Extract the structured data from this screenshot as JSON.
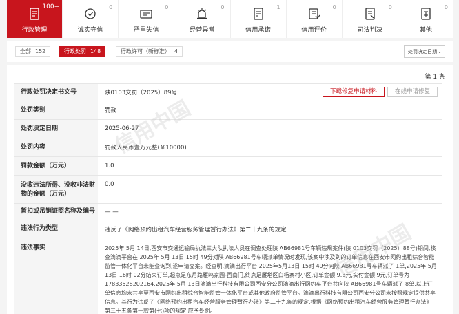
{
  "categories": [
    {
      "label": "行政管理",
      "count": "100+",
      "icon": "admin-doc-icon",
      "active": true
    },
    {
      "label": "诚实守信",
      "count": "0",
      "icon": "integrity-shield-icon",
      "active": false
    },
    {
      "label": "严重失信",
      "count": "0",
      "icon": "blacklist-icon",
      "active": false
    },
    {
      "label": "经营异常",
      "count": "0",
      "icon": "alarm-icon",
      "active": false
    },
    {
      "label": "信用承诺",
      "count": "1",
      "icon": "commitment-icon",
      "active": false
    },
    {
      "label": "信用评价",
      "count": "0",
      "icon": "evaluation-icon",
      "active": false
    },
    {
      "label": "司法判决",
      "count": "0",
      "icon": "judgment-icon",
      "active": false
    },
    {
      "label": "其他",
      "count": "0",
      "icon": "other-icon",
      "active": false
    }
  ],
  "filters": {
    "all_label": "全部",
    "all_count": "152",
    "penalty_label": "行政处罚",
    "penalty_count": "148",
    "permit_label": "行政许可（新标准）",
    "permit_count": "4",
    "sort_label": "处罚决定日期"
  },
  "page_note": "第 1 条",
  "actions": {
    "download": "下载修复申请材料",
    "online_repair": "在线申请修复"
  },
  "watermark": "信用中国",
  "detail": {
    "decision_no_key": "行政处罚决定书文号",
    "decision_no": "陕0103交罚（2025）89号",
    "category_key": "处罚类别",
    "category": "罚款",
    "date_key": "处罚决定日期",
    "date": "2025-06-27",
    "content_key": "处罚内容",
    "content": "罚款人民币壹万元整(￥10000)",
    "fine_key": "罚款金额（万元）",
    "fine": "1.0",
    "confiscate_key": "没收违法所得、没收非法财物的金额（万元）",
    "confiscate": "0.0",
    "license_key": "暂扣或吊销证照名称及编号",
    "license": "— —",
    "violation_type_key": "违法行为类型",
    "violation_type": "违反了《网络预约出租汽车经营服务管理暂行办法》第二十九条的规定",
    "facts_key": "违法事实",
    "facts": "2025年 5月 14日,西安市交通运输局执法三大队执法人员在调查处理陕 AB66981号车辆违规案件(陕 0103交罚（2025）88号)期间,核查滴滴平台在 2025年 5月 13日 15时 49分对陕 AB66981号车辆派单情况时发现,该案中涉及到的订单信息在西安市网约出租综合智能监管一体化平台未能查询到,遂申请立案。经查明,滴滴出行平台 2025年5月13日 15时 49分向陕 AB66981号车辆派了 1单,2025年 5月 13日 16时 02分结束订单,起点是东月路雁鸣家园-西南门,终点是雁塔区白杨寨村小区,订单金额 9.3元,实付金额 9元,订单号为 17833528202164,2025年 5月 13日滴滴出行科技有限公司西安分公司滴滴出行网约车平台共向陕 AB66981号车辆派了 8单,以上订单信息均未共享至西安市网约出租综合智能监管一体化平台或其他政府监管平台。滴滴出行科技有限公司西安分公司未按照规定提供共享信息。其行为违反了《网络预约出租汽车经营服务管理暂行办法》第二十九条的规定,根据《网络预约出租汽车经营服务管理暂行办法》第三十五条第一款第(七)项的规定,应予处罚。"
  }
}
